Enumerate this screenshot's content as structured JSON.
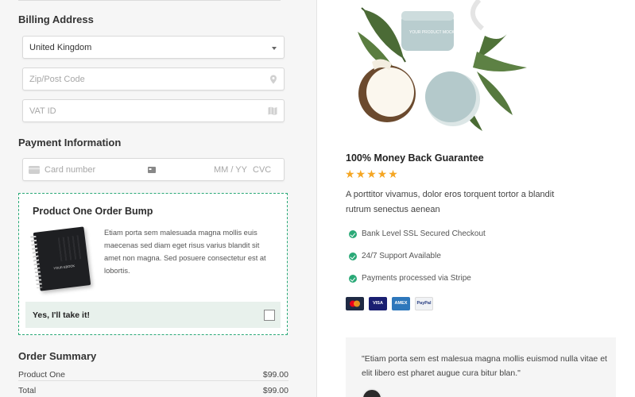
{
  "billing": {
    "title": "Billing Address",
    "country_value": "United Kingdom",
    "zip_placeholder": "Zip/Post Code",
    "vat_placeholder": "VAT ID"
  },
  "payment": {
    "title": "Payment Information",
    "card_placeholder": "Card number",
    "expiry_placeholder": "MM / YY",
    "cvc_placeholder": "CVC"
  },
  "bump": {
    "title": "Product One Order Bump",
    "description": "Etiam porta sem malesuada magna mollis euis maecenas sed diam eget risus varius blandit sit amet non magna. Sed posuere consectetur est at lobortis.",
    "notebook_text": "YOUR EBOOK",
    "accept_label": "Yes, I'll take it!"
  },
  "summary": {
    "title": "Order Summary",
    "rows": [
      {
        "label": "Product One",
        "amount": "$99.00"
      },
      {
        "label": "Total",
        "amount": "$99.00"
      }
    ]
  },
  "guarantee": {
    "title": "100% Money Back Guarantee",
    "rating": 5,
    "stars": "★★★★★",
    "description": "A porttitor vivamus, dolor eros torquent tortor a blandit rutrum senectus aenean",
    "features": [
      "Bank Level SSL Secured Checkout",
      "24/7 Support Available",
      "Payments processed via Stripe"
    ],
    "cards": [
      {
        "name": "mastercard-icon",
        "label": "●●"
      },
      {
        "name": "visa-icon",
        "label": "VISA"
      },
      {
        "name": "amex-icon",
        "label": "AMEX"
      },
      {
        "name": "paypal-icon",
        "label": "PayPal"
      }
    ]
  },
  "product_image": {
    "jar_label": "YOUR PRODUCT MOCKUP"
  },
  "testimonial": {
    "quote": "\"Etiam porta sem est malesua magna mollis euismod nulla vitae et elit libero est pharet augue cura bitur blan.\""
  },
  "colors": {
    "accent": "#2aa977",
    "star": "#f5a623",
    "bump_bg": "#e8f1ec"
  }
}
